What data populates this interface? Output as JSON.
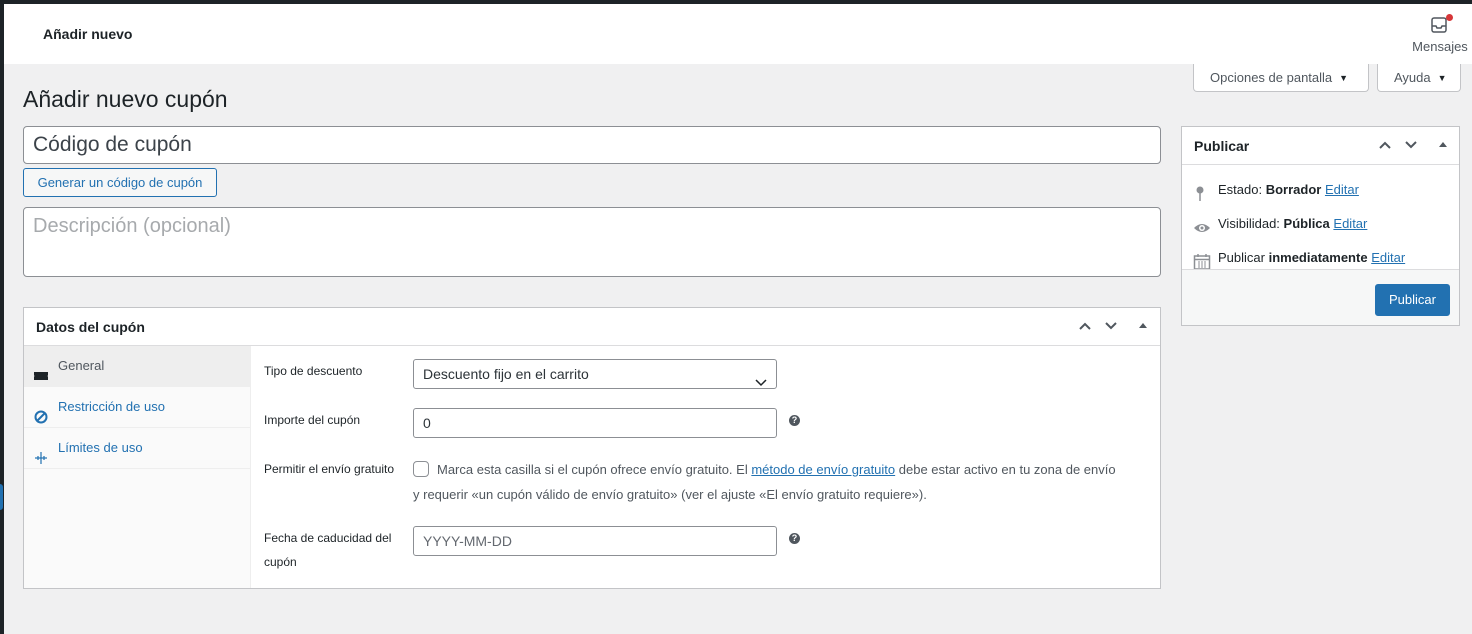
{
  "header": {
    "title": "Añadir nuevo",
    "messages_label": "Mensajes"
  },
  "screen_meta": {
    "screen_options": "Opciones de pantalla",
    "help": "Ayuda"
  },
  "page": {
    "title": "Añadir nuevo cupón"
  },
  "coupon": {
    "code_placeholder": "Código de cupón",
    "generate_button": "Generar un código de cupón",
    "description_placeholder": "Descripción (opcional)"
  },
  "coupon_data": {
    "title": "Datos del cupón",
    "tabs": [
      {
        "label": "General",
        "icon": "ticket-icon",
        "active": true
      },
      {
        "label": "Restricción de uso",
        "icon": "block-icon",
        "active": false
      },
      {
        "label": "Límites de uso",
        "icon": "limits-icon",
        "active": false
      }
    ],
    "fields": {
      "discount_type_label": "Tipo de descuento",
      "discount_type_value": "Descuento fijo en el carrito",
      "amount_label": "Importe del cupón",
      "amount_value": "0",
      "free_shipping_label": "Permitir el envío gratuito",
      "free_shipping_text_before": "Marca esta casilla si el cupón ofrece envío gratuito. El ",
      "free_shipping_link": "método de envío gratuito",
      "free_shipping_text_after": " debe estar activo en tu zona de envío y requerir «un cupón válido de envío gratuito» (ver el ajuste «El envío gratuito requiere»).",
      "free_shipping_checked": false,
      "expiry_label": "Fecha de caducidad del cupón",
      "expiry_placeholder": "YYYY-MM-DD"
    }
  },
  "publish": {
    "title": "Publicar",
    "status_label": "Estado: ",
    "status_value": "Borrador",
    "visibility_label": "Visibilidad: ",
    "visibility_value": "Pública",
    "schedule_label": "Publicar ",
    "schedule_value": "inmediatamente",
    "edit_link": "Editar",
    "publish_button": "Publicar"
  },
  "colors": {
    "accent": "#2271b1",
    "notification": "#d63638",
    "background": "#f0f0f1"
  }
}
